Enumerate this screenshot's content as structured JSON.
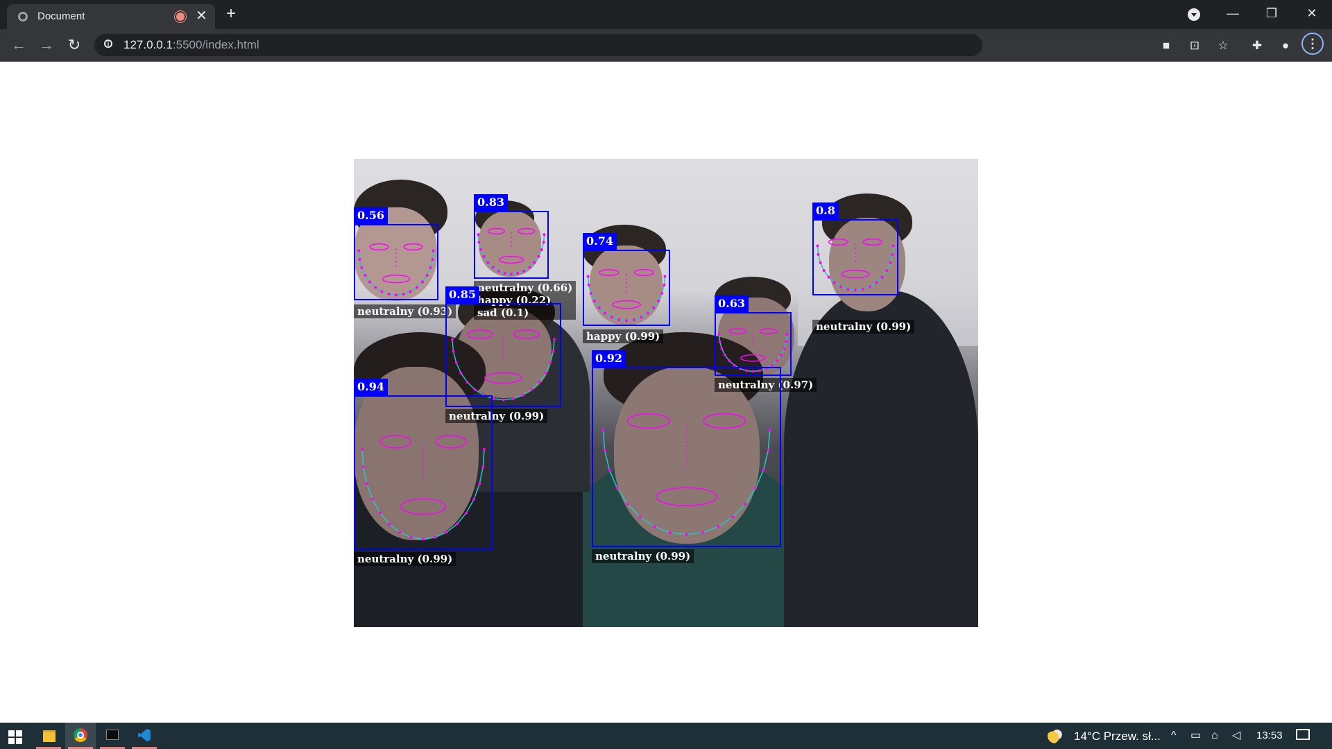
{
  "browser": {
    "tab_title": "Document",
    "url_host": "127.0.0.1",
    "url_path": ":5500/index.html",
    "tab_close": "✕",
    "new_tab": "+"
  },
  "window_controls": {
    "minimize": "—",
    "restore": "❐",
    "close": "✕"
  },
  "colors": {
    "box": "#0000ff",
    "landmark": "#ff00ff",
    "jawline": "#2ec4c4",
    "chrome_dark": "#202124",
    "taskbar": "#1f2f38"
  },
  "faces": [
    {
      "score": "0.56",
      "expressions": [
        "neutralny (0.93)"
      ]
    },
    {
      "score": "0.83",
      "expressions": [
        "neutralny (0.66)",
        "happy (0.22)",
        "sad (0.1)"
      ]
    },
    {
      "score": "0.74",
      "expressions": [
        "happy (0.99)"
      ]
    },
    {
      "score": "0.8",
      "expressions": [
        "neutralny (0.99)"
      ]
    },
    {
      "score": "0.85",
      "expressions": [
        "neutralny (0.99)"
      ]
    },
    {
      "score": "0.63",
      "expressions": [
        "neutralny (0.97)"
      ]
    },
    {
      "score": "0.92",
      "expressions": [
        "neutralny (0.99)"
      ]
    },
    {
      "score": "0.94",
      "expressions": [
        "neutralny (0.99)"
      ]
    }
  ],
  "taskbar": {
    "apps": [
      "windows-start",
      "file-explorer",
      "chrome",
      "terminal",
      "vscode"
    ],
    "weather": "14°C  Przew. sł...",
    "time": "13:53"
  }
}
